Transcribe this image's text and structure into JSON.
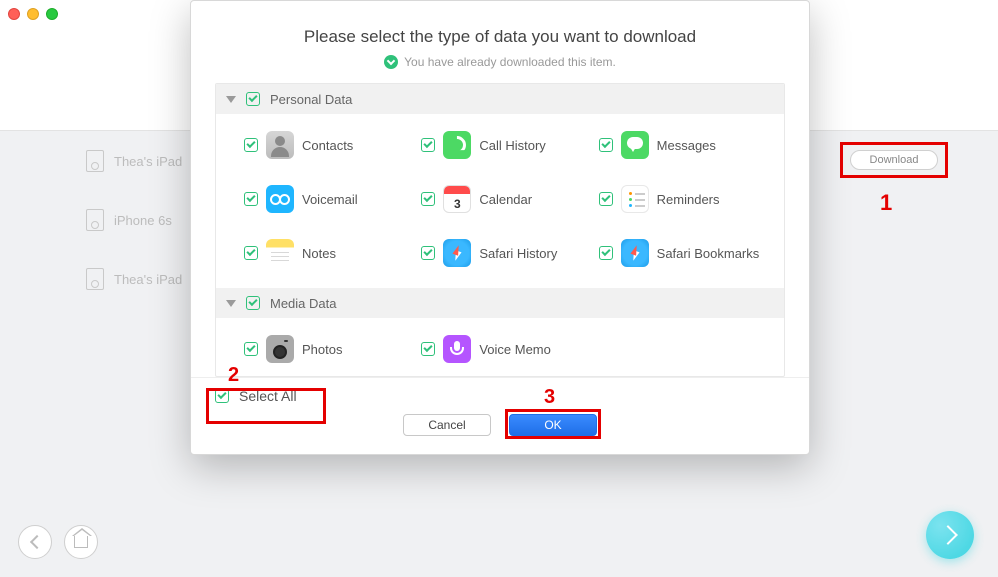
{
  "traffic": {
    "close": "close",
    "minimize": "minimize",
    "maximize": "maximize"
  },
  "sidebar": {
    "devices": [
      {
        "label": "Thea's iPad"
      },
      {
        "label": "iPhone 6s"
      },
      {
        "label": "Thea's iPad"
      }
    ]
  },
  "download_btn": "Download",
  "annotations": {
    "one": "1",
    "two": "2",
    "three": "3"
  },
  "modal": {
    "title": "Please select the type of data you want to download",
    "subtitle": "You have already downloaded this item.",
    "groups": [
      {
        "title": "Personal Data",
        "items": [
          {
            "label": "Contacts"
          },
          {
            "label": "Call History"
          },
          {
            "label": "Messages"
          },
          {
            "label": "Voicemail"
          },
          {
            "label": "Calendar",
            "cal_day": "3"
          },
          {
            "label": "Reminders"
          },
          {
            "label": "Notes"
          },
          {
            "label": "Safari History"
          },
          {
            "label": "Safari Bookmarks"
          }
        ]
      },
      {
        "title": "Media Data",
        "items": [
          {
            "label": "Photos"
          },
          {
            "label": "Voice Memo"
          }
        ]
      }
    ],
    "select_all": "Select All",
    "cancel": "Cancel",
    "ok": "OK"
  }
}
